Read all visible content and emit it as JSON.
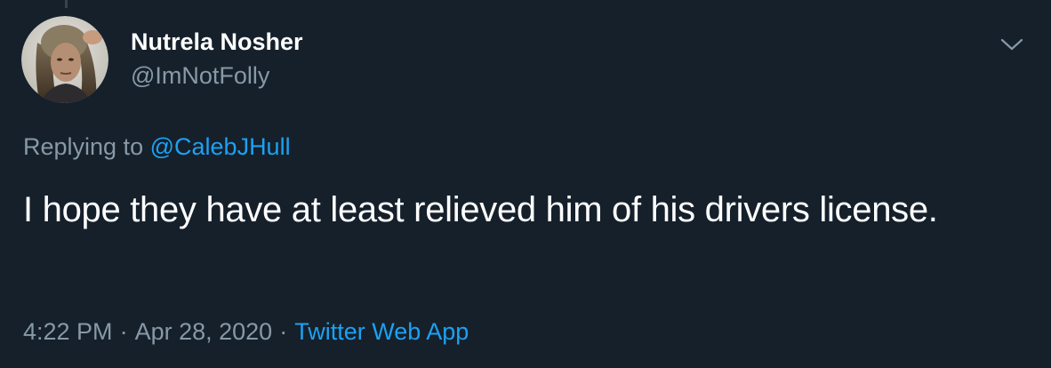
{
  "user": {
    "display_name": "Nutrela Nosher",
    "handle": "@ImNotFolly",
    "avatar_icon": "user-avatar-photo"
  },
  "reply": {
    "prefix": "Replying to",
    "mention": "@CalebJHull"
  },
  "tweet": {
    "text": "I hope they have at least relieved him of his drivers license."
  },
  "meta": {
    "time": "4:22 PM",
    "separator": "·",
    "date": "Apr 28, 2020",
    "source": "Twitter Web App"
  },
  "icons": {
    "more": "chevron-down-icon"
  },
  "colors": {
    "background": "#15202b",
    "primary_text": "#ffffff",
    "secondary_text": "#8899a6",
    "accent": "#1da1f2",
    "thread_line": "#38444d"
  }
}
